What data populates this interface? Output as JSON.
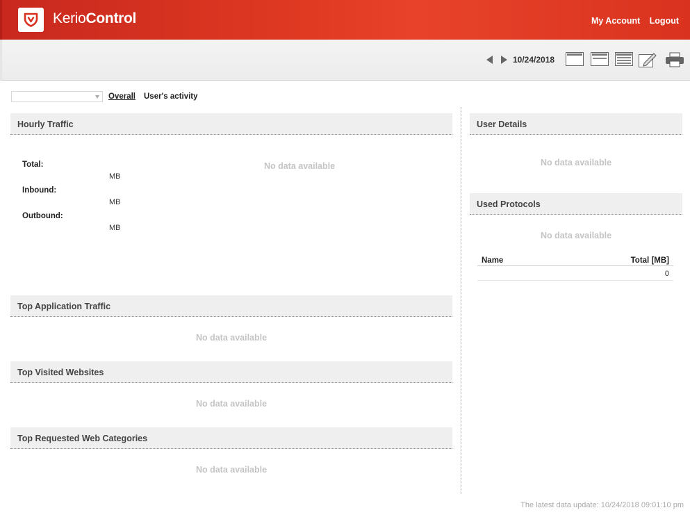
{
  "header": {
    "brand_light": "Kerio",
    "brand_bold": "Control",
    "my_account": "My Account",
    "logout": "Logout",
    "accent_color": "#e03a22"
  },
  "toolbar": {
    "date": "10/24/2018",
    "icons": [
      "arrow-left-icon",
      "arrow-right-icon",
      "day-view-icon",
      "week-view-icon",
      "month-view-icon",
      "edit-icon",
      "print-icon"
    ]
  },
  "filter": {
    "select_value": "",
    "tab_overall": "Overall",
    "tab_activity": "User's activity"
  },
  "hourly": {
    "title": "Hourly Traffic",
    "nodata": "No data available",
    "total_label": "Total:",
    "total_unit": "MB",
    "inbound_label": "Inbound:",
    "inbound_unit": "MB",
    "outbound_label": "Outbound:",
    "outbound_unit": "MB"
  },
  "top_apps": {
    "title": "Top Application Traffic",
    "nodata": "No data available"
  },
  "top_sites": {
    "title": "Top Visited Websites",
    "nodata": "No data available"
  },
  "top_categories": {
    "title": "Top Requested Web Categories",
    "nodata": "No data available"
  },
  "user_details": {
    "title": "User Details",
    "nodata": "No data available"
  },
  "protocols": {
    "title": "Used Protocols",
    "nodata": "No data available",
    "col_name": "Name",
    "col_total": "Total [MB]",
    "rows": [
      {
        "name": "",
        "total": "0"
      }
    ]
  },
  "footer": {
    "last_update": "The latest data update: 10/24/2018 09:01:10 pm"
  }
}
